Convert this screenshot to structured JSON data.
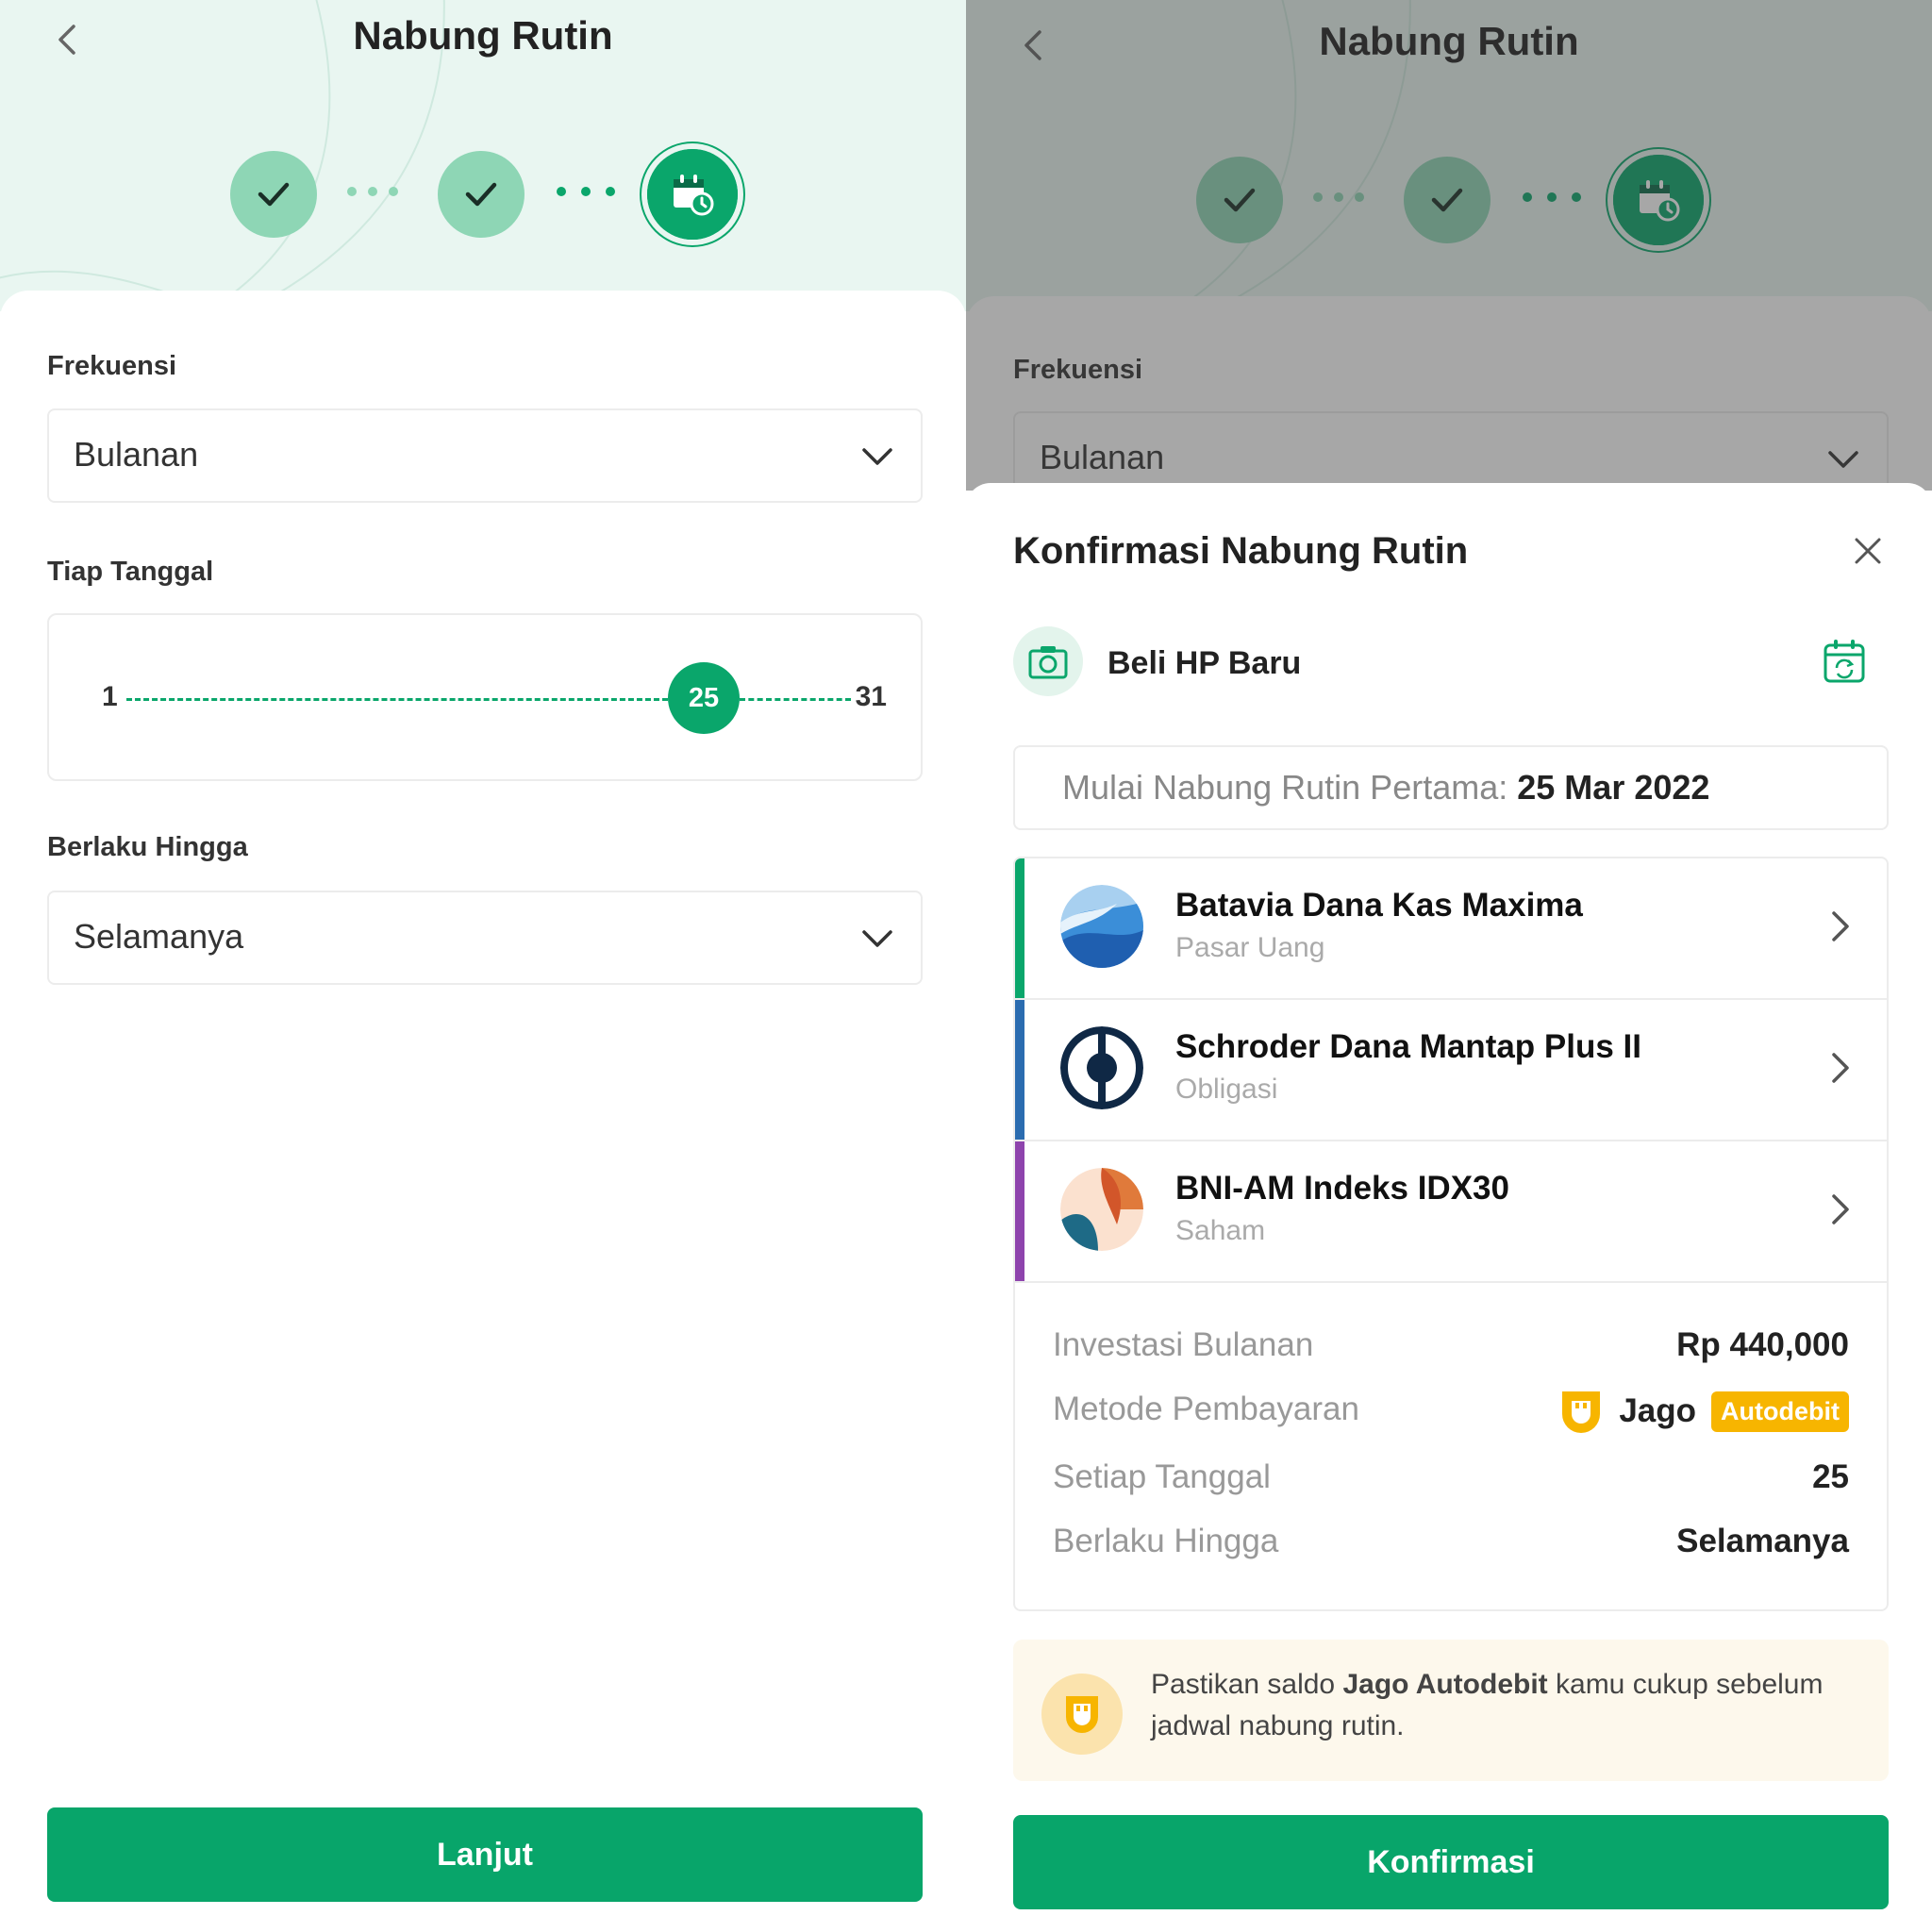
{
  "left": {
    "header": {
      "title": "Nabung Rutin"
    },
    "frequency": {
      "label": "Frekuensi",
      "value": "Bulanan"
    },
    "date": {
      "label": "Tiap Tanggal",
      "min": "1",
      "max": "31",
      "selected": "25"
    },
    "until": {
      "label": "Berlaku Hingga",
      "value": "Selamanya"
    },
    "next_button": "Lanjut"
  },
  "right": {
    "header": {
      "title": "Nabung Rutin"
    },
    "frequency": {
      "label": "Frekuensi",
      "value": "Bulanan"
    },
    "sheet": {
      "title": "Konfirmasi Nabung Rutin",
      "goal": "Beli HP Baru",
      "start_label": "Mulai Nabung Rutin Pertama:",
      "start_date": "25 Mar 2022",
      "funds": [
        {
          "name": "Batavia Dana Kas Maxima",
          "category": "Pasar Uang",
          "color": "#0aa66b"
        },
        {
          "name": "Schroder Dana Mantap Plus II",
          "category": "Obligasi",
          "color": "#2b6cb0"
        },
        {
          "name": "BNI-AM Indeks IDX30",
          "category": "Saham",
          "color": "#8e44ad"
        }
      ],
      "summary": {
        "investment_label": "Investasi Bulanan",
        "investment_value": "Rp 440,000",
        "payment_label": "Metode Pembayaran",
        "payment_name": "Jago",
        "payment_badge": "Autodebit",
        "day_label": "Setiap Tanggal",
        "day_value": "25",
        "until_label": "Berlaku Hingga",
        "until_value": "Selamanya"
      },
      "notice": {
        "pre": "Pastikan saldo ",
        "bold": "Jago Autodebit",
        "post": " kamu cukup sebelum jadwal nabung rutin."
      },
      "confirm_button": "Konfirmasi"
    }
  },
  "colors": {
    "primary": "#08a56a",
    "primary_light": "#8ed6b5",
    "header_bg": "#e9f6f1",
    "autodebit": "#f7b500"
  }
}
